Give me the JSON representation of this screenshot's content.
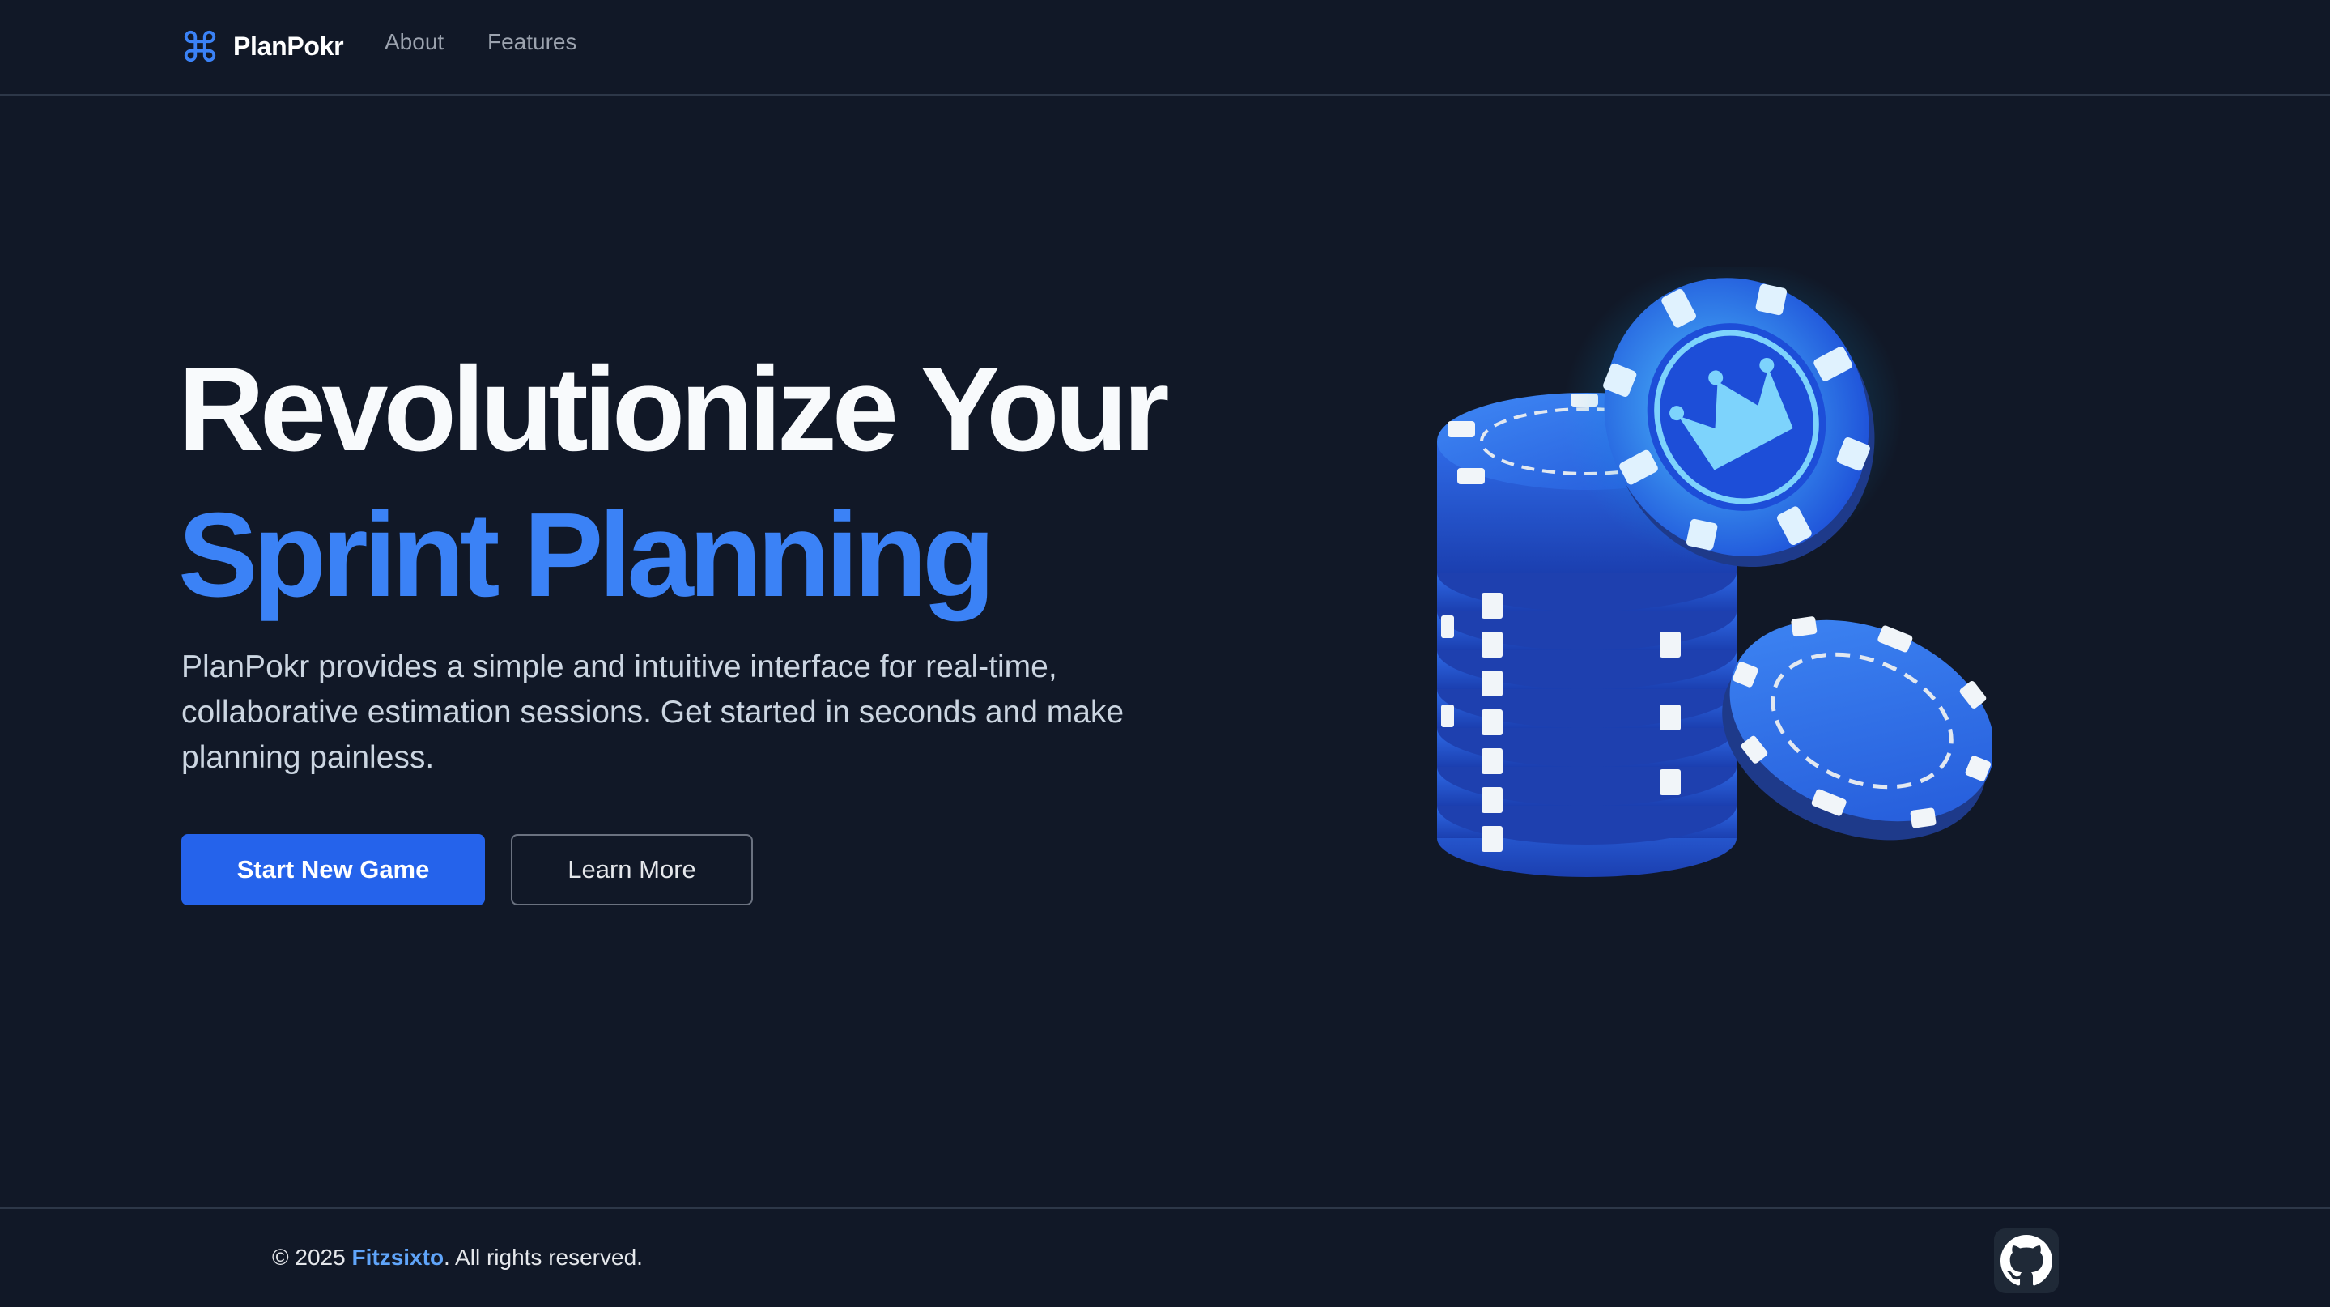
{
  "header": {
    "brand": "PlanPokr",
    "brand_icon": "command-icon",
    "nav": [
      {
        "label": "About"
      },
      {
        "label": "Features"
      }
    ]
  },
  "hero": {
    "title_line1": "Revolutionize Your",
    "title_line2": "Sprint Planning",
    "description": "PlanPokr provides a simple and intuitive interface for real-time, collaborative estimation sessions. Get started in seconds and make planning painless.",
    "primary_button": "Start New Game",
    "secondary_button": "Learn More",
    "image": "poker-chips-illustration"
  },
  "footer": {
    "copyright_prefix": "© 2025 ",
    "author": "Fitzsixto",
    "copyright_suffix": ". All rights reserved.",
    "github_icon": "github-icon"
  },
  "colors": {
    "background": "#111827",
    "accent": "#3b82f6",
    "primary_button": "#2563eb",
    "link": "#60a5fa"
  }
}
